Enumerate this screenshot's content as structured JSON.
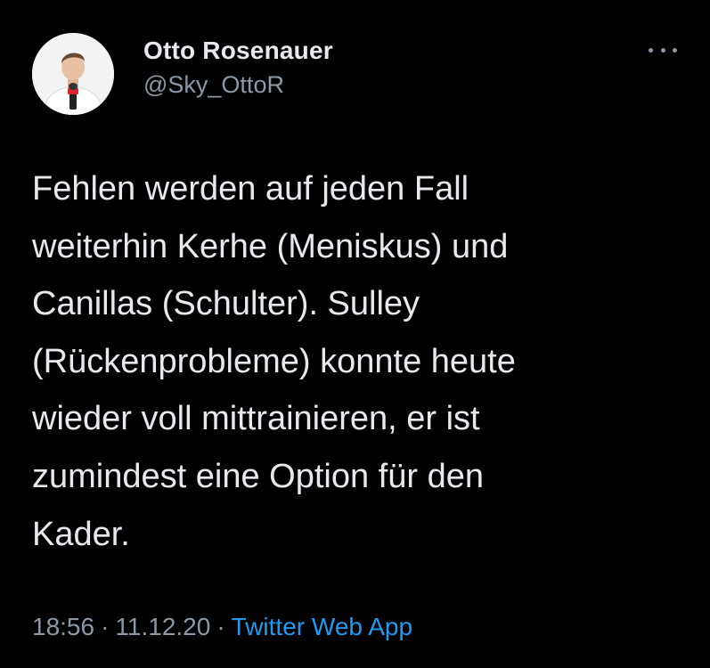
{
  "user": {
    "name": "Otto Rosenauer",
    "handle": "@Sky_OttoR",
    "avatar_icon": "profile-photo"
  },
  "tweet": {
    "text": "Fehlen werden auf jeden Fall\nweiterhin Kerhe (Meniskus) und\nCanillas (Schulter). Sulley\n(Rückenprobleme) konnte heute\nwieder voll mittrainieren, er ist\nzumindest eine Option für den\nKader.",
    "time": "18:56",
    "date": "11.12.20",
    "source": "Twitter Web App",
    "separator": "·"
  },
  "menu": {
    "icon": "more-horizontal-icon"
  },
  "colors": {
    "background": "#000000",
    "text_primary": "#e7e9ea",
    "text_secondary": "#8b98a5",
    "accent": "#1d9bf0"
  }
}
